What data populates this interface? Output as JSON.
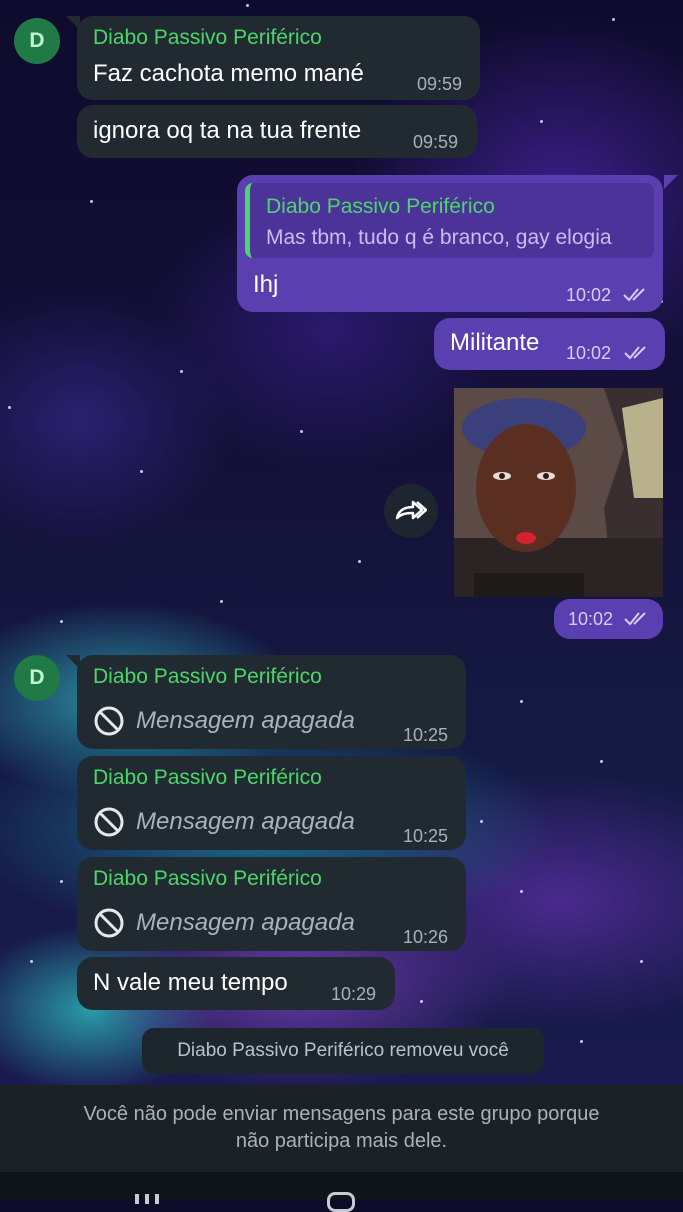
{
  "group_sender": "Diabo Passivo Periférico",
  "avatar_initial": "D",
  "messages": {
    "m1": {
      "text": "Faz cachota memo mané",
      "time": "09:59"
    },
    "m2": {
      "text": "ignora oq ta na tua frente",
      "time": "09:59"
    },
    "m3": {
      "quote_sender": "Diabo Passivo Periférico",
      "quote_text": "Mas tbm, tudo q é branco, gay elogia",
      "text": "Ihj",
      "time": "10:02"
    },
    "m4": {
      "text": "Militante",
      "time": "10:02"
    },
    "m5": {
      "time": "10:02"
    },
    "m6": {
      "text": "Mensagem apagada",
      "time": "10:25"
    },
    "m7": {
      "text": "Mensagem apagada",
      "time": "10:25"
    },
    "m8": {
      "text": "Mensagem apagada",
      "time": "10:26"
    },
    "m9": {
      "text": "N vale meu tempo",
      "time": "10:29"
    }
  },
  "system_message": "Diabo Passivo Periférico removeu você",
  "footer": {
    "line1": "Você não pode enviar mensagens para este grupo porque",
    "line2": "não participa mais dele."
  },
  "colors": {
    "incoming_bubble": "#212a31",
    "outgoing_bubble": "#5a3fb0",
    "sender_name": "#4cd66a",
    "avatar": "#1f7a45"
  },
  "icons": [
    "double-check-icon",
    "forward-icon",
    "deleted-message-icon"
  ]
}
